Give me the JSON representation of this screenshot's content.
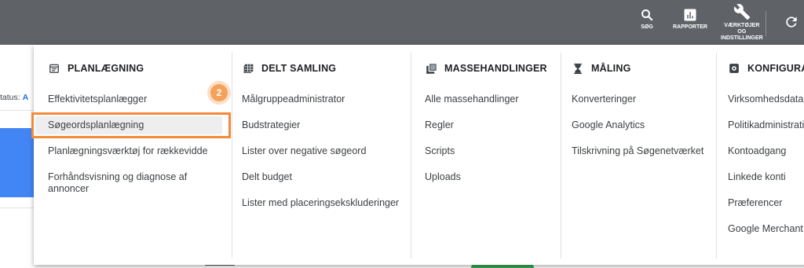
{
  "toolbar": {
    "search": {
      "label": "SØG",
      "icon": "search-icon"
    },
    "reports": {
      "label": "RAPPORTER",
      "icon": "bar-chart-icon"
    },
    "tools": {
      "label": "VÆRKTØJER\nOG\nINDSTILLINGER",
      "icon": "wrench-icon"
    },
    "refresh": {
      "icon": "refresh-icon"
    }
  },
  "background": {
    "status_prefix": "tatus:",
    "status_value": "A"
  },
  "step_badge": "2",
  "accent_color": "#f28b3c",
  "menu": {
    "columns": [
      {
        "title": "PLANLÆGNING",
        "icon": "calendar-icon",
        "items": [
          "Effektivitetsplanlægger",
          "Søgeordsplanlægning",
          "Planlægningsværktøj for rækkevidde",
          "Forhåndsvisning og diagnose af annoncer"
        ]
      },
      {
        "title": "DELT SAMLING",
        "icon": "library-grid-icon",
        "items": [
          "Målgruppeadministrator",
          "Budstrategier",
          "Lister over negative søgeord",
          "Delt budget",
          "Lister med placeringsekskluderinger"
        ]
      },
      {
        "title": "MASSEHANDLINGER",
        "icon": "copy-stack-icon",
        "items": [
          "Alle massehandlinger",
          "Regler",
          "Scripts",
          "Uploads"
        ]
      },
      {
        "title": "MÅLING",
        "icon": "hourglass-icon",
        "items": [
          "Konverteringer",
          "Google Analytics",
          "Tilskrivning på Søgenetværket"
        ]
      },
      {
        "title": "KONFIGURATION",
        "icon": "settings-box-icon",
        "items": [
          "Virksomhedsdata",
          "Politikadministration",
          "Kontoadgang",
          "Linkede konti",
          "Præferencer",
          "Google Merchant Center"
        ]
      }
    ]
  }
}
